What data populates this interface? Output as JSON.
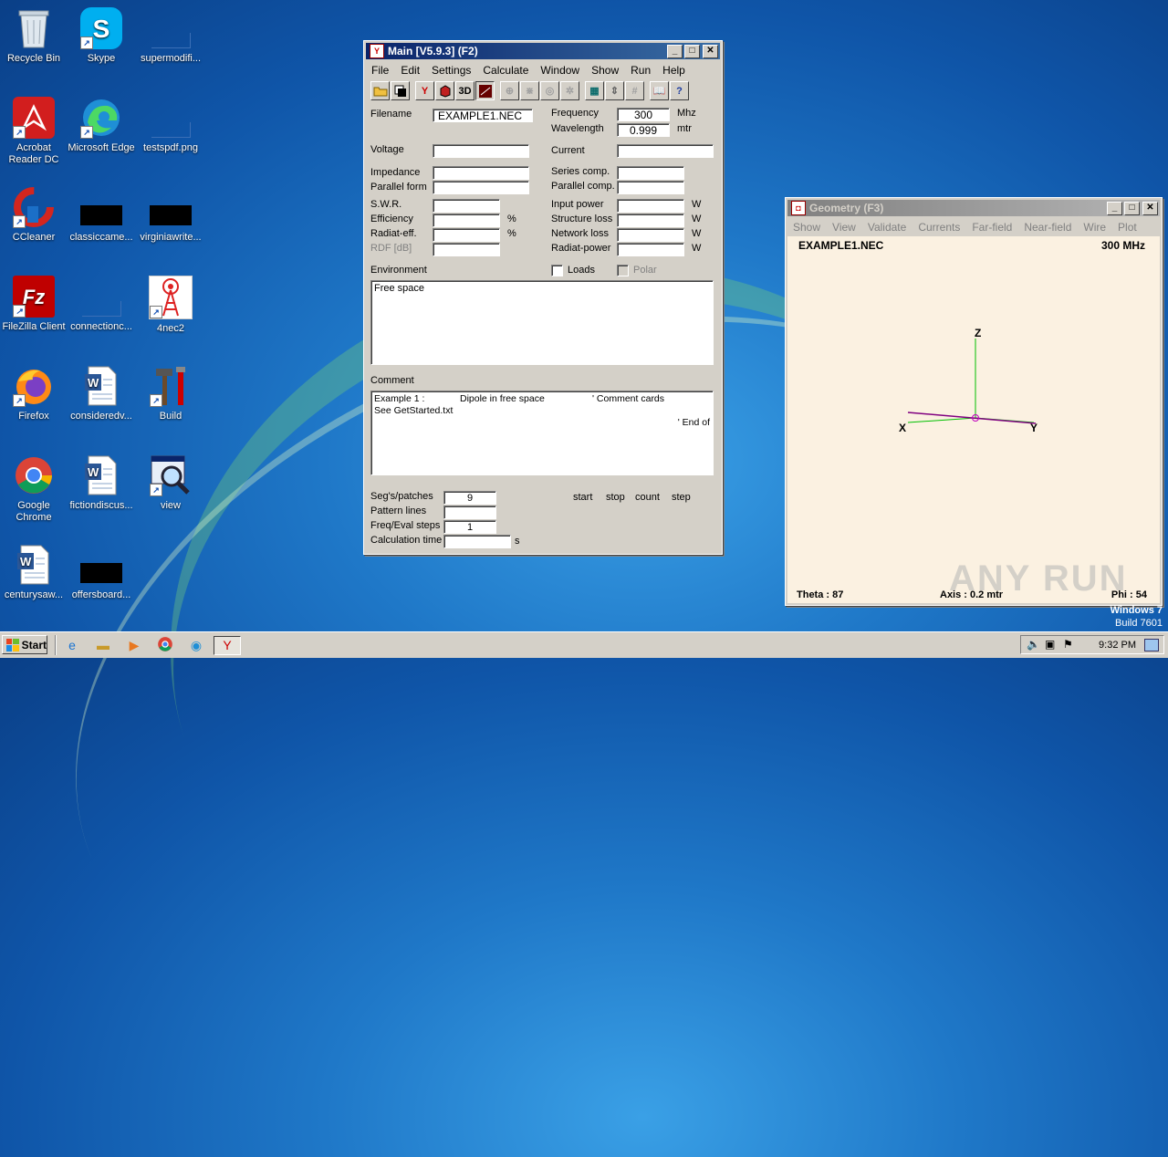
{
  "desktop": {
    "icons": [
      {
        "label": "Recycle Bin"
      },
      {
        "label": "Skype"
      },
      {
        "label": "supermodifi..."
      },
      {
        "label": "Acrobat Reader DC"
      },
      {
        "label": "Microsoft Edge"
      },
      {
        "label": "testspdf.png"
      },
      {
        "label": "CCleaner"
      },
      {
        "label": "classiccame..."
      },
      {
        "label": "virginiawrite..."
      },
      {
        "label": "FileZilla Client"
      },
      {
        "label": "connectionc..."
      },
      {
        "label": "4nec2"
      },
      {
        "label": "Firefox"
      },
      {
        "label": "consideredv..."
      },
      {
        "label": "Build"
      },
      {
        "label": "Google Chrome"
      },
      {
        "label": "fictiondiscus..."
      },
      {
        "label": "view"
      },
      {
        "label": "centurysaw..."
      },
      {
        "label": "offersboard..."
      }
    ],
    "watermark": "ANY RUN",
    "os_line1": "Windows 7",
    "os_line2": "Build 7601"
  },
  "main": {
    "title": "Main [V5.9.3]  (F2)",
    "menu": [
      "File",
      "Edit",
      "Settings",
      "Calculate",
      "Window",
      "Show",
      "Run",
      "Help"
    ],
    "toolbar_3d": "3D",
    "labels": {
      "filename": "Filename",
      "voltage": "Voltage",
      "impedance": "Impedance",
      "parallel_form": "Parallel form",
      "swr": "S.W.R.",
      "efficiency": "Efficiency",
      "radiat_eff": "Radiat-eff.",
      "rdf": "RDF [dB]",
      "frequency": "Frequency",
      "wavelength": "Wavelength",
      "current": "Current",
      "series_comp": "Series comp.",
      "parallel_comp": "Parallel comp.",
      "input_power": "Input power",
      "structure_loss": "Structure loss",
      "network_loss": "Network loss",
      "radiat_power": "Radiat-power",
      "environment": "Environment",
      "loads": "Loads",
      "polar": "Polar",
      "comment": "Comment",
      "segs": "Seg's/patches",
      "pattern_lines": "Pattern lines",
      "freq_steps": "Freq/Eval steps",
      "calc_time": "Calculation time",
      "start": "start",
      "stop": "stop",
      "count": "count",
      "step": "step"
    },
    "units": {
      "mhz": "Mhz",
      "mtr": "mtr",
      "pct1": "%",
      "pct2": "%",
      "w1": "W",
      "w2": "W",
      "w3": "W",
      "w4": "W",
      "s": "s"
    },
    "values": {
      "filename": "EXAMPLE1.NEC",
      "frequency": "300",
      "wavelength": "0.999",
      "environment": "Free space",
      "comment_line1_a": "Example 1 :",
      "comment_line1_b": "Dipole in free space",
      "comment_line1_c": "' Comment cards",
      "comment_line2": "See GetStarted.txt",
      "comment_line3": "' End of",
      "segs": "9",
      "freq_steps": "1"
    }
  },
  "geometry": {
    "title": "Geometry   (F3)",
    "menu": [
      "Show",
      "View",
      "Validate",
      "Currents",
      "Far-field",
      "Near-field",
      "Wire",
      "Plot"
    ],
    "file": "EXAMPLE1.NEC",
    "freq": "300 MHz",
    "axis_z": "Z",
    "axis_x": "X",
    "axis_y": "Y",
    "theta": "Theta : 87",
    "axis_len": "Axis : 0.2 mtr",
    "phi": "Phi : 54"
  },
  "taskbar": {
    "start": "Start",
    "time": "9:32 PM"
  }
}
